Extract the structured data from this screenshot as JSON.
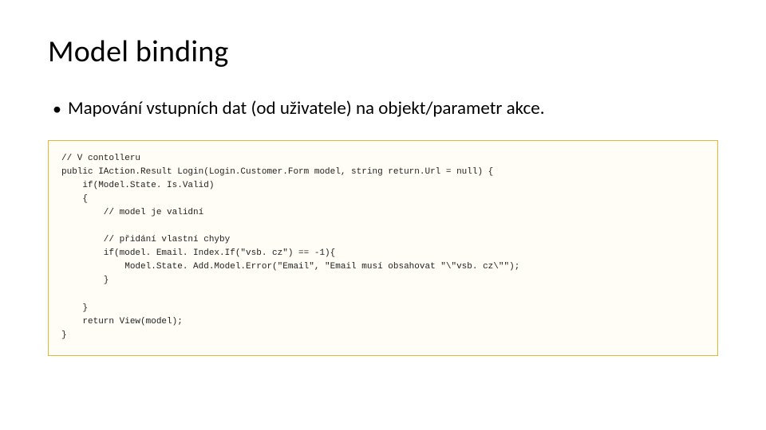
{
  "title": "Model binding",
  "bullet": "Mapování vstupních dat (od uživatele) na objekt/parametr akce.",
  "code": "// V contolleru\npublic IAction.Result Login(Login.Customer.Form model, string return.Url = null) {\n    if(Model.State. Is.Valid)\n    {\n        // model je validní\n\n        // přidání vlastní chyby\n        if(model. Email. Index.If(\"vsb. cz\") == -1){\n            Model.State. Add.Model.Error(\"Email\", \"Email musí obsahovat \"\\\"vsb. cz\\\"\");\n        }\n\n    }\n    return View(model);\n}"
}
